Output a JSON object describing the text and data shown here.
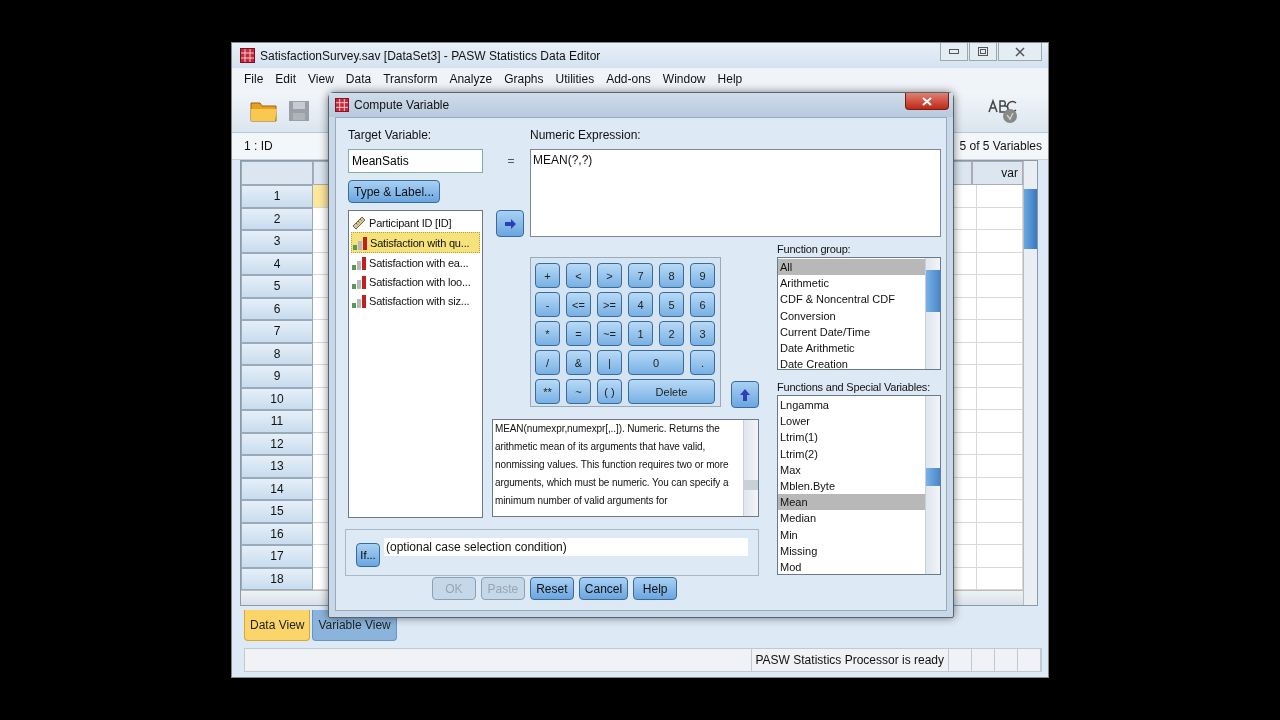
{
  "window": {
    "title": "SatisfactionSurvey.sav [DataSet3] - PASW Statistics Data Editor"
  },
  "menu": [
    "File",
    "Edit",
    "View",
    "Data",
    "Transform",
    "Analyze",
    "Graphs",
    "Utilities",
    "Add-ons",
    "Window",
    "Help"
  ],
  "cell_ref": "1 : ID",
  "variables_count": "5 of 5 Variables",
  "grid": {
    "column_header": "var",
    "row_numbers": [
      "1",
      "2",
      "3",
      "4",
      "5",
      "6",
      "7",
      "8",
      "9",
      "10",
      "11",
      "12",
      "13",
      "14",
      "15",
      "16",
      "17",
      "18"
    ]
  },
  "view_tabs": [
    {
      "label": "Data View",
      "selected": true
    },
    {
      "label": "Variable View",
      "selected": false
    }
  ],
  "status": "PASW Statistics Processor is ready",
  "dialog": {
    "title": "Compute Variable",
    "target_label": "Target Variable:",
    "target_value": "MeanSatis",
    "equals": "=",
    "type_label_button": "Type & Label...",
    "expression_label": "Numeric Expression:",
    "expression_value": "MEAN(?,?)",
    "variables": [
      {
        "name": "Participant ID [ID]",
        "kind": "scale",
        "selected": false
      },
      {
        "name": "Satisfaction with qu...",
        "kind": "ordinal",
        "selected": true
      },
      {
        "name": "Satisfaction with ea...",
        "kind": "ordinal",
        "selected": false
      },
      {
        "name": "Satisfaction with loo...",
        "kind": "ordinal",
        "selected": false
      },
      {
        "name": "Satisfaction with siz...",
        "kind": "ordinal",
        "selected": false
      }
    ],
    "keypad": [
      [
        "+",
        "<",
        ">",
        "7",
        "8",
        "9"
      ],
      [
        "-",
        "<=",
        ">=",
        "4",
        "5",
        "6"
      ],
      [
        "*",
        "=",
        "~=",
        "1",
        "2",
        "3"
      ],
      [
        "/",
        "&",
        "|",
        "0",
        "."
      ],
      [
        "**",
        "~",
        "( )",
        "Delete"
      ]
    ],
    "description": "MEAN(numexpr,numexpr[,..]). Numeric. Returns the arithmetic mean of its arguments that have valid, nonmissing values. This function requires two or more arguments, which must be numeric. You can specify a minimum number of valid arguments for",
    "function_group_label": "Function group:",
    "function_groups": [
      {
        "label": "All",
        "selected": true
      },
      {
        "label": "Arithmetic",
        "selected": false
      },
      {
        "label": "CDF & Noncentral CDF",
        "selected": false
      },
      {
        "label": "Conversion",
        "selected": false
      },
      {
        "label": "Current Date/Time",
        "selected": false
      },
      {
        "label": "Date Arithmetic",
        "selected": false
      },
      {
        "label": "Date Creation",
        "selected": false
      }
    ],
    "functions_label": "Functions and Special Variables:",
    "functions": [
      {
        "label": "Lngamma",
        "selected": false
      },
      {
        "label": "Lower",
        "selected": false
      },
      {
        "label": "Ltrim(1)",
        "selected": false
      },
      {
        "label": "Ltrim(2)",
        "selected": false
      },
      {
        "label": "Max",
        "selected": false
      },
      {
        "label": "Mblen.Byte",
        "selected": false
      },
      {
        "label": "Mean",
        "selected": true
      },
      {
        "label": "Median",
        "selected": false
      },
      {
        "label": "Min",
        "selected": false
      },
      {
        "label": "Missing",
        "selected": false
      },
      {
        "label": "Mod",
        "selected": false
      }
    ],
    "if_button": "If...",
    "condition": "(optional case selection condition)",
    "buttons": [
      {
        "label": "OK",
        "disabled": true
      },
      {
        "label": "Paste",
        "disabled": true
      },
      {
        "label": "Reset",
        "disabled": false
      },
      {
        "label": "Cancel",
        "disabled": false
      },
      {
        "label": "Help",
        "disabled": false
      }
    ]
  }
}
